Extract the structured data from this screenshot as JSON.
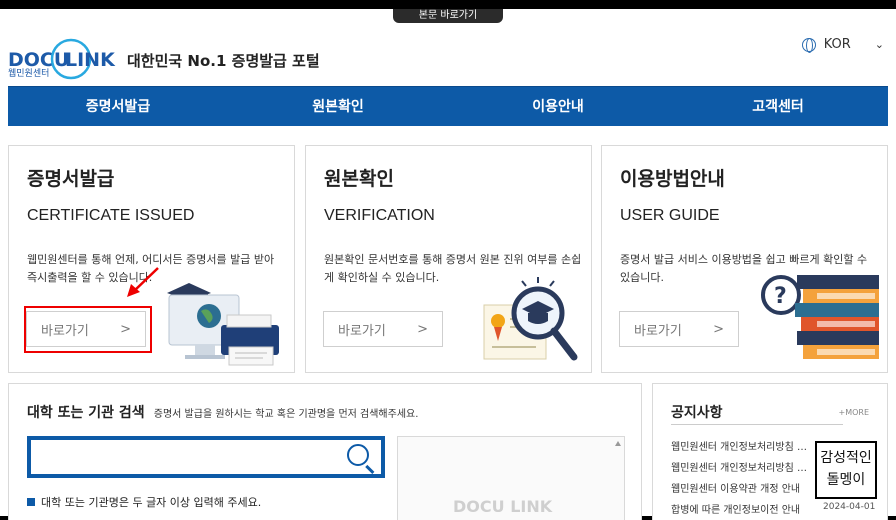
{
  "skip_link": "본문 바로가기",
  "header": {
    "logo_text": "DOCU LINK",
    "logo_sub": "웹민원센터",
    "tagline": "대한민국 No.1 증명발급 포털",
    "language": "KOR",
    "icons": {
      "language": "globe-icon",
      "dropdown": "chevron-down-icon"
    }
  },
  "nav": {
    "items": [
      {
        "label": "증명서발급"
      },
      {
        "label": "원본확인"
      },
      {
        "label": "이용안내"
      },
      {
        "label": "고객센터"
      }
    ]
  },
  "cards": [
    {
      "title": "증명서발급",
      "subtitle": "CERTIFICATE ISSUED",
      "desc": "웹민원센터를 통해 언제, 어디서든 증명서를 발급 받아 즉시출력을 할 수 있습니다.",
      "button": "바로가기",
      "button_arrow": ">"
    },
    {
      "title": "원본확인",
      "subtitle": "VERIFICATION",
      "desc": "원본확인 문서번호를 통해 증명서 원본 진위 여부를 손쉽게 확인하실 수 있습니다.",
      "button": "바로가기",
      "button_arrow": ">"
    },
    {
      "title": "이용방법안내",
      "subtitle": "USER GUIDE",
      "desc": "증명서 발급 서비스 이용방법을 쉽고 빠르게 확인할 수 있습니다.",
      "button": "바로가기",
      "button_arrow": ">"
    }
  ],
  "search": {
    "title": "대학 또는 기관 검색",
    "hint": "증명서 발급을 원하시는 학교 혹은 기관명을 먼저 검색해주세요.",
    "input_value": "",
    "placeholder": "",
    "note": "대학 또는 기관명은 두 글자 이상 입력해 주세요.",
    "watermark": "DOCU LINK"
  },
  "notice": {
    "title": "공지사항",
    "more": "+MORE",
    "items": [
      "웹민원센터 개인정보처리방침 …",
      "웹민원센터 개인정보처리방침 …",
      "웹민원센터 이용약관 개정 안내",
      "합병에 따른 개인정보이전 안내"
    ],
    "last_date": "2024-04-01"
  },
  "stamp": {
    "line1": "감성적인",
    "line2": "돌멩이"
  },
  "colors": {
    "brand_blue": "#0d5aa7",
    "highlight_red": "#e00000"
  }
}
